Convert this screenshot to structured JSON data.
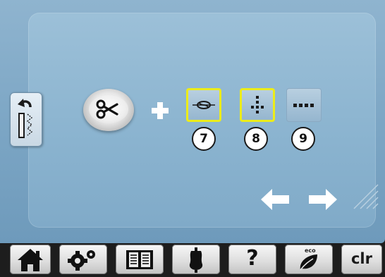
{
  "buttons": {
    "option_7_label": "7",
    "option_8_label": "8",
    "option_9_label": "9"
  },
  "toolbar": {
    "help_label": "?",
    "eco_label": "eco",
    "clr_label": "clr"
  },
  "icons": {
    "side_tab": "stitch-back-icon",
    "cutter": "scissors-icon",
    "plus": "plus-icon",
    "option_7": "thread-knot-icon",
    "option_8": "dot-cross-icon",
    "option_9": "dash-line-icon",
    "back": "arrow-left-icon",
    "forward": "arrow-right-icon",
    "home": "home-icon",
    "setup": "gear-icon",
    "tutorial": "book-icon",
    "consultant": "mannequin-icon",
    "help": "help-icon",
    "eco": "eco-icon"
  },
  "colors": {
    "selection_frame": "#ecec1a",
    "panel_blue": "#8ab3cf",
    "toolbar_bg": "#1d1d1d"
  }
}
